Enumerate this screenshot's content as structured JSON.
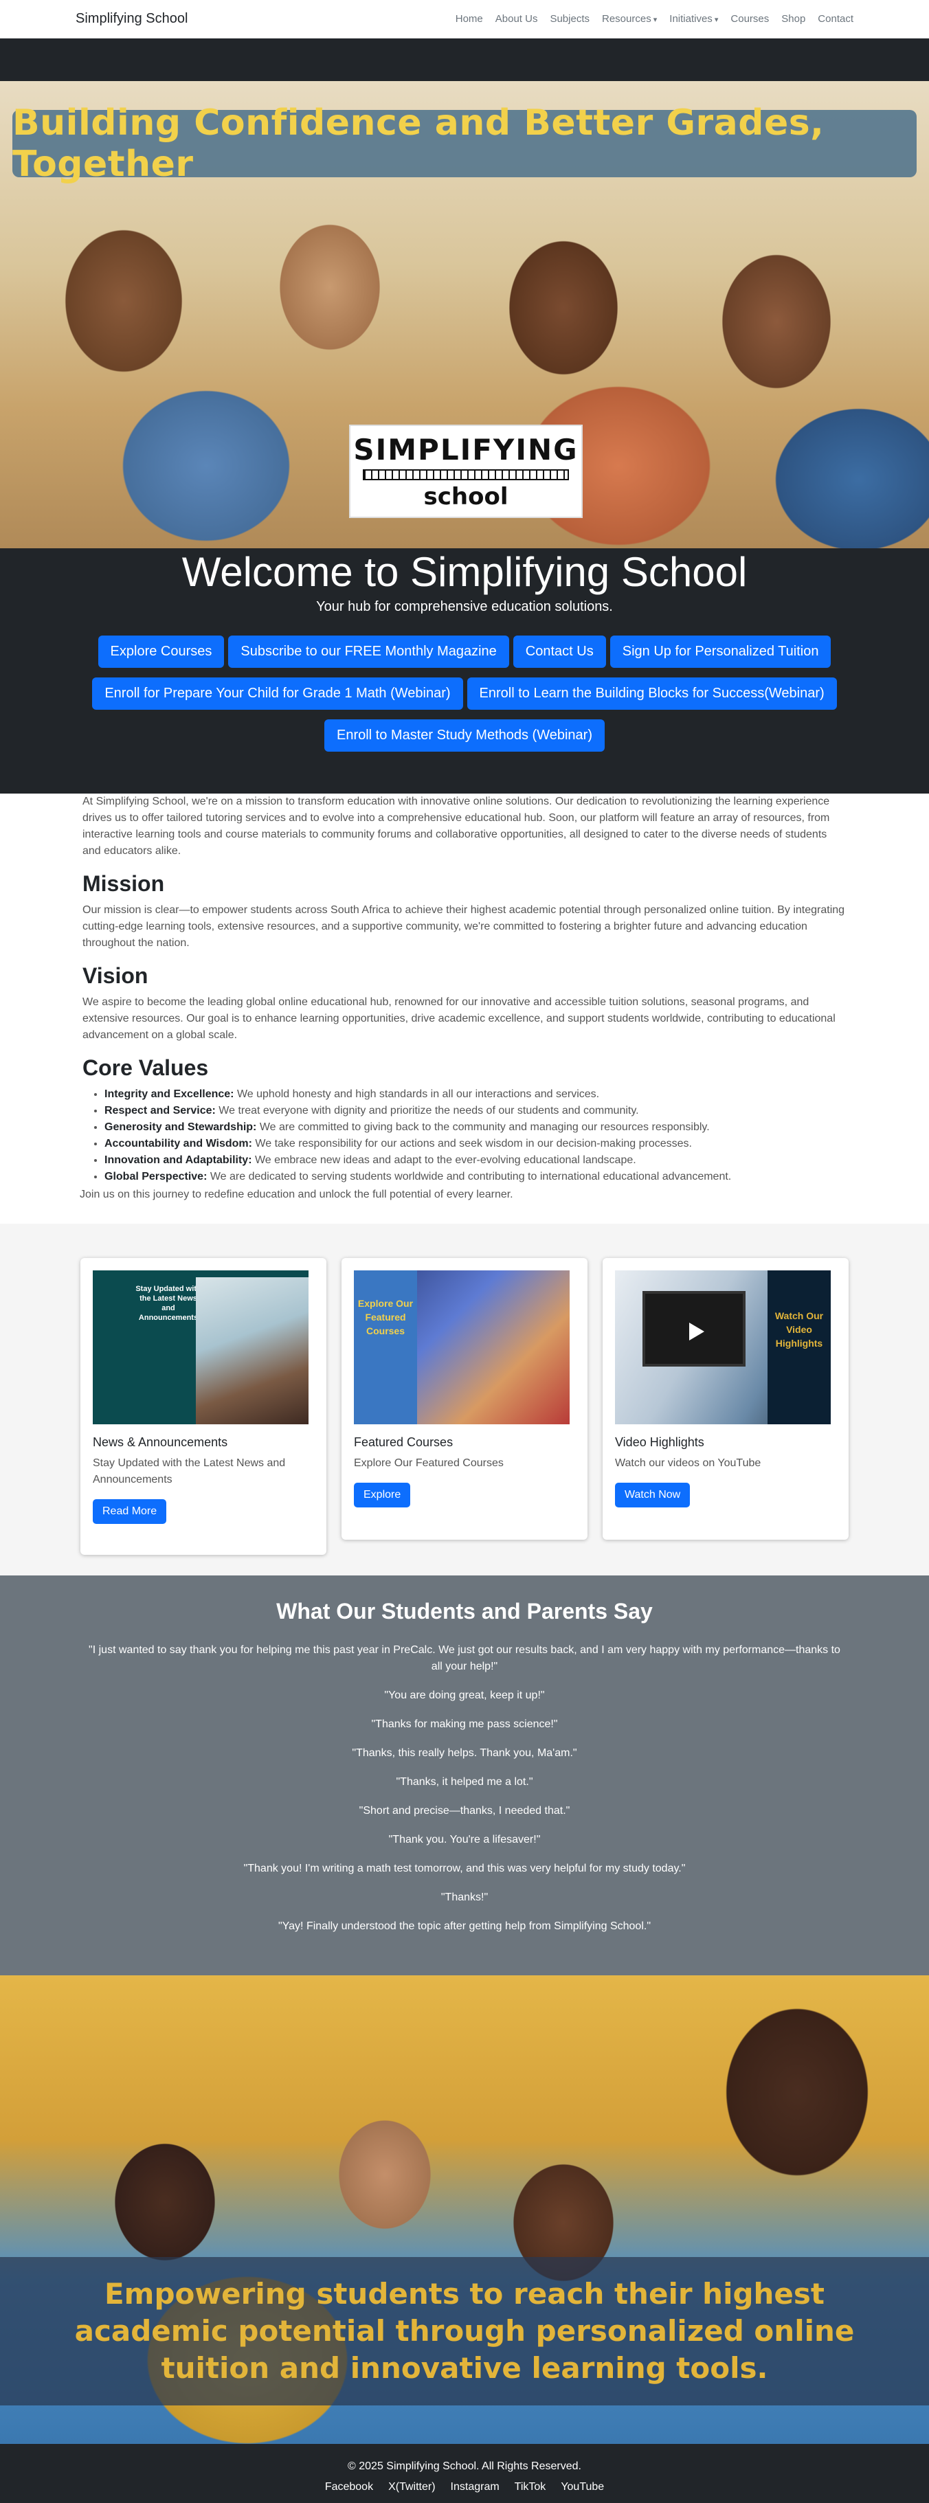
{
  "nav": {
    "brand": "Simplifying School",
    "items": [
      "Home",
      "About Us",
      "Subjects",
      "Resources",
      "Initiatives",
      "Courses",
      "Shop",
      "Contact"
    ],
    "dropdown_items": [
      "Resources",
      "Initiatives"
    ]
  },
  "hero": {
    "title": "Building Confidence and Better Grades, Together",
    "logo_top": "SIMPLIFYING",
    "logo_bottom": "school"
  },
  "welcome": {
    "heading": "Welcome to Simplifying School",
    "subtitle": "Your hub for comprehensive education solutions.",
    "buttons": [
      "Explore Courses",
      "Subscribe to our FREE Monthly Magazine",
      "Contact Us",
      "Sign Up for Personalized Tuition",
      "Enroll for Prepare Your Child for Grade 1 Math (Webinar)",
      "Enroll to Learn the Building Blocks for Success(Webinar)",
      "Enroll to Master Study Methods (Webinar)"
    ]
  },
  "about": {
    "intro": "At Simplifying School, we're on a mission to transform education with innovative online solutions. Our dedication to revolutionizing the learning experience drives us to offer tailored tutoring services and to evolve into a comprehensive educational hub. Soon, our platform will feature an array of resources, from interactive learning tools and course materials to community forums and collaborative opportunities, all designed to cater to the diverse needs of students and educators alike.",
    "mission_heading": "Mission",
    "mission_text": "Our mission is clear—to empower students across South Africa to achieve their highest academic potential through personalized online tuition. By integrating cutting-edge learning tools, extensive resources, and a supportive community, we're committed to fostering a brighter future and advancing education throughout the nation.",
    "vision_heading": "Vision",
    "vision_text": "We aspire to become the leading global online educational hub, renowned for our innovative and accessible tuition solutions, seasonal programs, and extensive resources. Our goal is to enhance learning opportunities, drive academic excellence, and support students worldwide, contributing to educational advancement on a global scale.",
    "values_heading": "Core Values",
    "values": [
      {
        "term": "Integrity and Excellence:",
        "desc": " We uphold honesty and high standards in all our interactions and services."
      },
      {
        "term": "Respect and Service:",
        "desc": " We treat everyone with dignity and prioritize the needs of our students and community."
      },
      {
        "term": "Generosity and Stewardship:",
        "desc": " We are committed to giving back to the community and managing our resources responsibly."
      },
      {
        "term": "Accountability and Wisdom:",
        "desc": " We take responsibility for our actions and seek wisdom in our decision-making processes."
      },
      {
        "term": "Innovation and Adaptability:",
        "desc": " We embrace new ideas and adapt to the ever-evolving educational landscape."
      },
      {
        "term": "Global Perspective:",
        "desc": " We are dedicated to serving students worldwide and contributing to international educational advancement."
      }
    ],
    "closing": "Join us on this journey to redefine education and unlock the full potential of every learner."
  },
  "cards": [
    {
      "img_text": "Stay Updated with the Latest News and Announcements",
      "title": "News & Announcements",
      "text": "Stay Updated with the Latest News and Announcements",
      "button": "Read More"
    },
    {
      "img_text": "Explore Our Featured Courses",
      "title": "Featured Courses",
      "text": "Explore Our Featured Courses",
      "button": "Explore"
    },
    {
      "img_text": "Watch Our Video Highlights",
      "title": "Video Highlights",
      "text": "Watch our videos on YouTube",
      "button": "Watch Now"
    }
  ],
  "testimonials": {
    "heading": "What Our Students and Parents Say",
    "quotes": [
      "\"I just wanted to say thank you for helping me this past year in PreCalc. We just got our results back, and I am very happy with my performance—thanks to all your help!\"",
      "\"You are doing great, keep it up!\"",
      "\"Thanks for making me pass science!\"",
      "\"Thanks, this really helps. Thank you, Ma'am.\"",
      "\"Thanks, it helped me a lot.\"",
      "\"Short and precise—thanks, I needed that.\"",
      "\"Thank you. You're a lifesaver!\"",
      "\"Thank you! I'm writing a math test tomorrow, and this was very helpful for my study today.\"",
      "\"Thanks!\"",
      "\"Yay! Finally understood the topic after getting help from Simplifying School.\""
    ]
  },
  "bottom_banner": {
    "text": "Empowering students to reach their highest academic potential through personalized online tuition and innovative learning tools."
  },
  "footer": {
    "copyright": "© 2025 Simplifying School. All Rights Reserved.",
    "links": [
      "Facebook",
      "X(Twitter)",
      "Instagram",
      "TikTok",
      "YouTube"
    ]
  }
}
